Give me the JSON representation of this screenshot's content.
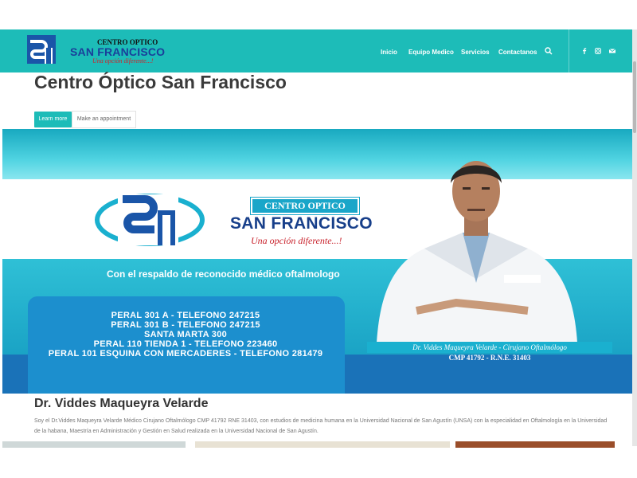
{
  "brand": {
    "line1": "CENTRO OPTICO",
    "line2": "SAN FRANCISCO",
    "line3": "Una opción diferente...!"
  },
  "nav": {
    "items": [
      "Inicio",
      "Equipo Medico",
      "Servicios",
      "Contactanos"
    ],
    "search_icon": "search-icon",
    "social_icons": [
      "facebook-icon",
      "instagram-icon",
      "mail-icon"
    ]
  },
  "hero": {
    "title": "Centro Óptico San Francisco",
    "learn_more": "Learn more",
    "appointment": "Make an appointment"
  },
  "banner": {
    "box_label": "CENTRO OPTICO",
    "name": "SAN FRANCISCO",
    "tagline": "Una opción diferente...!",
    "support": "Con el respaldo de reconocido médico oftalmologo",
    "addresses": [
      "PERAL 301 A - TELEFONO 247215",
      "PERAL 301 B - TELEFONO 247215",
      "SANTA MARTA 300",
      "PERAL 110 TIENDA 1 - TELEFONO 223460",
      "PERAL 101 ESQUINA CON MERCADERES - TELEFONO 281479"
    ],
    "caption_name": "Dr. Viddes Maqueyra Velarde - Cirujano Oftalmólogo",
    "caption_reg": "CMP 41792 - R.N.E. 31403"
  },
  "about": {
    "heading": "Dr. Viddes Maqueyra Velarde",
    "text": "Soy el Dr.Viddes Maqueyra Velarde Médico Cirujano Oftalmólogo CMP 41792 RNE 31403, con estudios de medicina humana en la Universidad Nacional de San Agustín (UNSA) con la especialidad en Oftalmología en la Universidad de la habana, Maestría en Administración y Gestión en Salud realizada en la Universidad Nacional de San Agustín."
  },
  "colors": {
    "accent": "#1dbcb8",
    "brand_blue": "#1a3f9a",
    "brand_red": "#d0222a"
  }
}
